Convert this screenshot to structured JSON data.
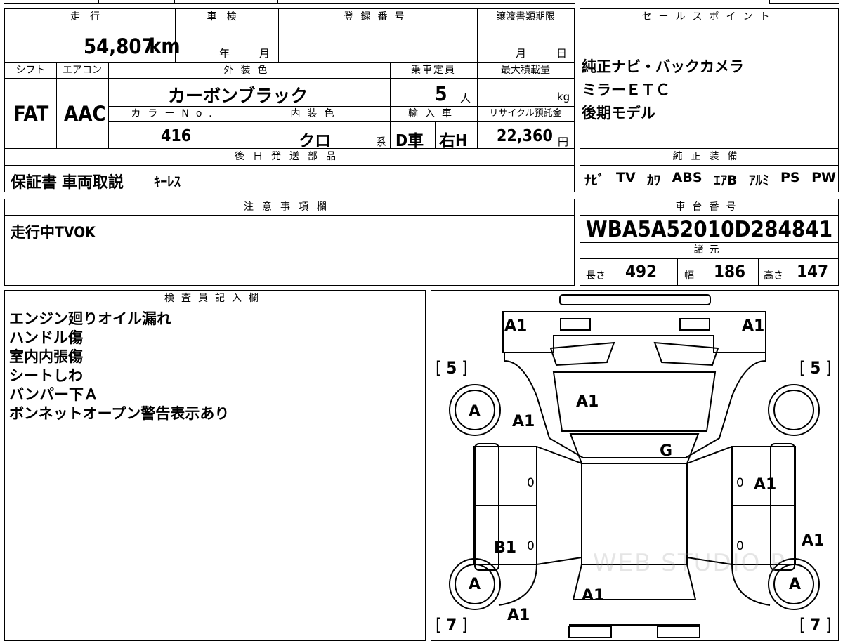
{
  "top_table": {
    "headers": {
      "mileage": "走行",
      "inspection": "車検",
      "registration_number": "登録番号",
      "transfer_deadline": "譲渡書類期限",
      "shift": "シフト",
      "aircon": "エアコン",
      "exterior_color": "外装色",
      "capacity": "乗車定員",
      "max_load": "最大積載量",
      "color_no": "カラーNo.",
      "interior_color": "内装色",
      "import": "輸入車",
      "recycle_fee": "リサイクル預託金"
    },
    "mileage": "54,807",
    "mileage_unit": "km",
    "inspection_year": "年",
    "inspection_month": "月",
    "deadline_month": "月",
    "deadline_day": "日",
    "shift": "FAT",
    "aircon": "AAC",
    "exterior_color": "カーボンブラック",
    "capacity": "5",
    "capacity_unit": "人",
    "max_load_unit": "kg",
    "color_no": "416",
    "interior_color": "クロ",
    "interior_suffix": "系",
    "import_type": "D車",
    "steering": "右H",
    "recycle_fee": "22,360",
    "recycle_unit": "円"
  },
  "later_parts": {
    "header": "後日発送部品",
    "value_main": "保証書 車両取説",
    "value_sub": "ｷｰﾚｽ"
  },
  "sales_points": {
    "header": "セールスポイント",
    "lines": [
      "純正ナビ・バックカメラ",
      "ミラーＥＴＣ",
      "後期モデル"
    ]
  },
  "equipment": {
    "header": "純正装備",
    "items": [
      "ﾅﾋﾞ",
      "TV",
      "ｶﾜ",
      "ABS",
      "ｴｱB",
      "ｱﾙﾐ",
      "PS",
      "PW"
    ]
  },
  "notes": {
    "header": "注意事項欄",
    "text": "走行中TVOK"
  },
  "chassis": {
    "header": "車台番号",
    "number": "WBA5A52010D284841",
    "specs_header": "諸元",
    "length_label": "長さ",
    "length": "492",
    "width_label": "幅",
    "width": "186",
    "height_label": "高さ",
    "height": "147"
  },
  "inspector": {
    "header": "検査員記入欄",
    "lines": [
      "エンジン廻りオイル漏れ",
      "ハンドル傷",
      "室内内張傷",
      "シートしわ",
      "バンパー下Ａ",
      "ボンネットオープン警告表示あり"
    ]
  },
  "diagram": {
    "tire_front_left": "5",
    "tire_front_right": "5",
    "tire_rear_left": "7",
    "tire_rear_right": "7",
    "marks": {
      "front_bumper_left": "A1",
      "front_bumper_right": "A1",
      "hood": "A1",
      "front_fender_left": "A1",
      "windshield": "G",
      "front_door_right": "A1",
      "rear_door_right": "A1",
      "rear_door_left": "B1",
      "trunk": "A1",
      "rear_bumper_left": "A1",
      "wheel_front_left": "A",
      "wheel_rear_left": "A",
      "wheel_rear_right": "A",
      "door_small_1": "0",
      "door_small_2": "0",
      "door_small_3": "0",
      "door_small_4": "0"
    },
    "watermark": "WEB STUDIO P"
  }
}
